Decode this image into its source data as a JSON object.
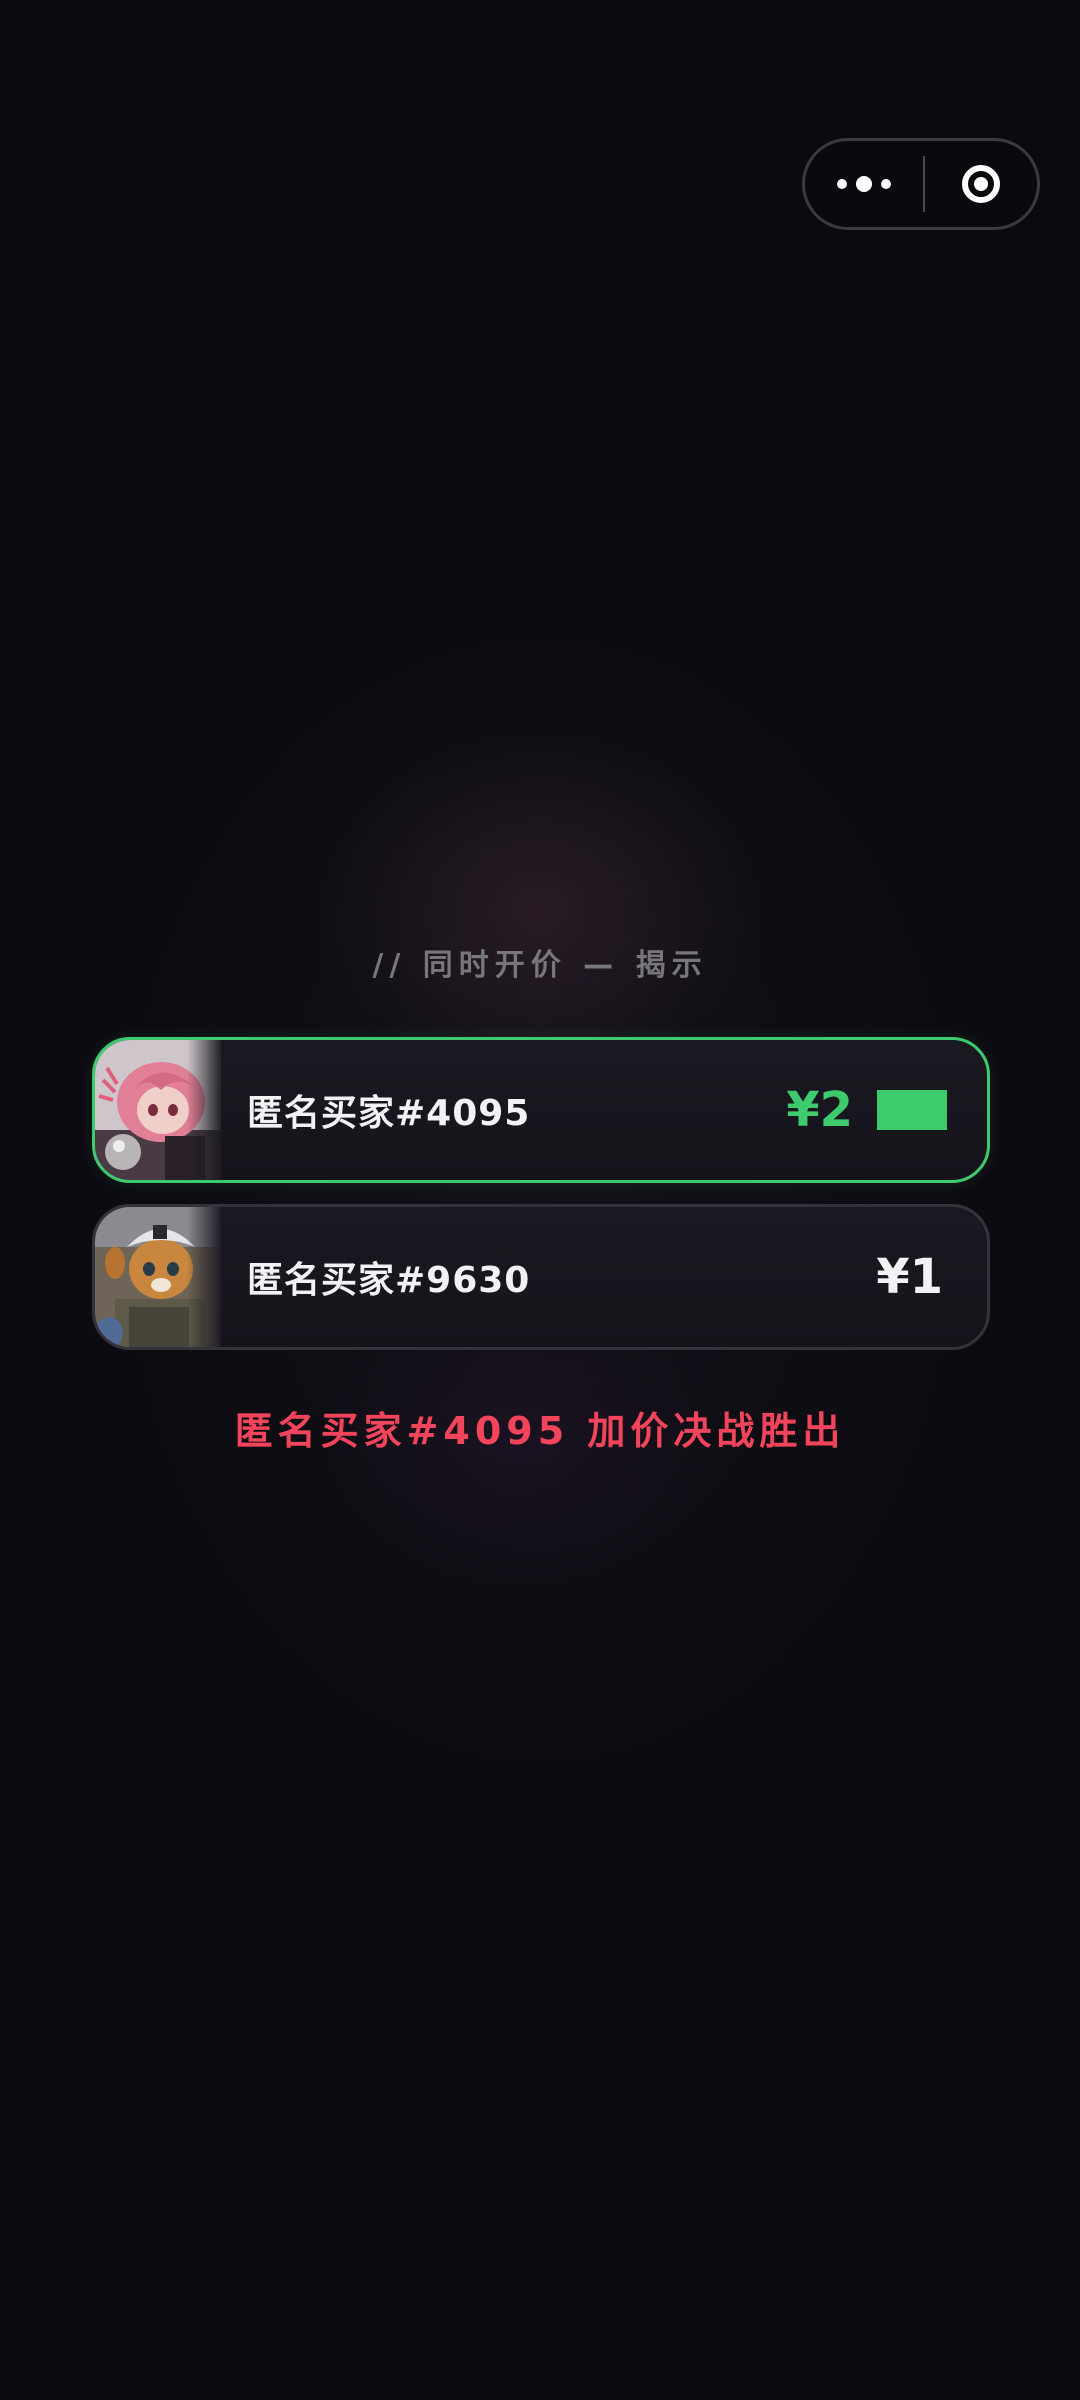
{
  "reveal_label": "// 同时开价 — 揭示",
  "bids": [
    {
      "buyer": "匿名买家#4095",
      "price": "¥2",
      "status": "winner",
      "avatar": "pink-haired-figurine-avatar"
    },
    {
      "buyer": "匿名买家#9630",
      "price": "¥1",
      "status": "loser",
      "avatar": "tabby-cat-soldier-avatar"
    }
  ],
  "result": "匿名买家#4095 加价决战胜出",
  "capsule": {
    "more_icon": "more-dots-icon",
    "close_icon": "close-target-icon"
  },
  "colors": {
    "background": "#0b0a10",
    "winner_accent": "#3ecb6e",
    "result_text": "#f2455c",
    "label_text": "#77767d"
  }
}
